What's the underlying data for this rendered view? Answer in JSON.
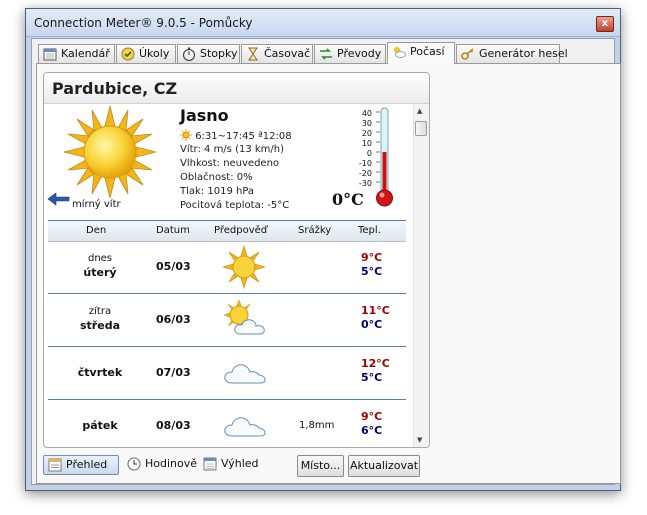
{
  "window": {
    "title": "Connection Meter® 9.0.5 - Pomůcky",
    "close_glyph": "x"
  },
  "tabs": [
    {
      "label": "Kalendář",
      "icon": "calendar-icon"
    },
    {
      "label": "Úkoly",
      "icon": "tasks-icon"
    },
    {
      "label": "Stopky",
      "icon": "stopwatch-icon"
    },
    {
      "label": "Časovač",
      "icon": "hourglass-icon"
    },
    {
      "label": "Převody",
      "icon": "converter-icon"
    },
    {
      "label": "Počasí",
      "icon": "weather-icon",
      "active": true
    },
    {
      "label": "Generátor hesel",
      "icon": "key-icon"
    }
  ],
  "weather": {
    "city": "Pardubice, CZ",
    "condition": "Jasno",
    "sun_times": "6:31~17:45 ª12:08",
    "wind": "Vítr: 4 m/s (13 km/h)",
    "humidity": "Vlhkost: neuvedeno",
    "cloudiness": "Oblačnost: 0%",
    "pressure": "Tlak: 1019 hPa",
    "feels_like": "Pocitová teplota: -5°C",
    "wind_label": "mírný vítr",
    "current_temp": "0°C",
    "thermometer_scale": [
      "40",
      "30",
      "20",
      "10",
      "0",
      "-10",
      "-20",
      "-30"
    ]
  },
  "forecast": {
    "headers": {
      "day": "Den",
      "date": "Datum",
      "forecast": "Předpověď",
      "precipitation": "Srážky",
      "temp": "Tepl."
    },
    "rows": [
      {
        "day1": "dnes",
        "day2": "úterý",
        "date": "05/03",
        "icon": "sun-icon",
        "precip": "",
        "high": "9°C",
        "low": "5°C"
      },
      {
        "day1": "zítra",
        "day2": "středa",
        "date": "06/03",
        "icon": "sun-cloud-icon",
        "precip": "",
        "high": "11°C",
        "low": "0°C"
      },
      {
        "day1": "",
        "day2": "čtvrtek",
        "date": "07/03",
        "icon": "cloud-icon",
        "precip": "",
        "high": "12°C",
        "low": "5°C"
      },
      {
        "day1": "",
        "day2": "pátek",
        "date": "08/03",
        "icon": "cloud-icon",
        "precip": "1,8mm",
        "high": "9°C",
        "low": "6°C"
      }
    ]
  },
  "bottom": {
    "view_overview": "Přehled",
    "view_hourly": "Hodinově",
    "view_outlook": "Výhled",
    "location_button": "Místo...",
    "refresh_button": "Aktualizovat"
  }
}
